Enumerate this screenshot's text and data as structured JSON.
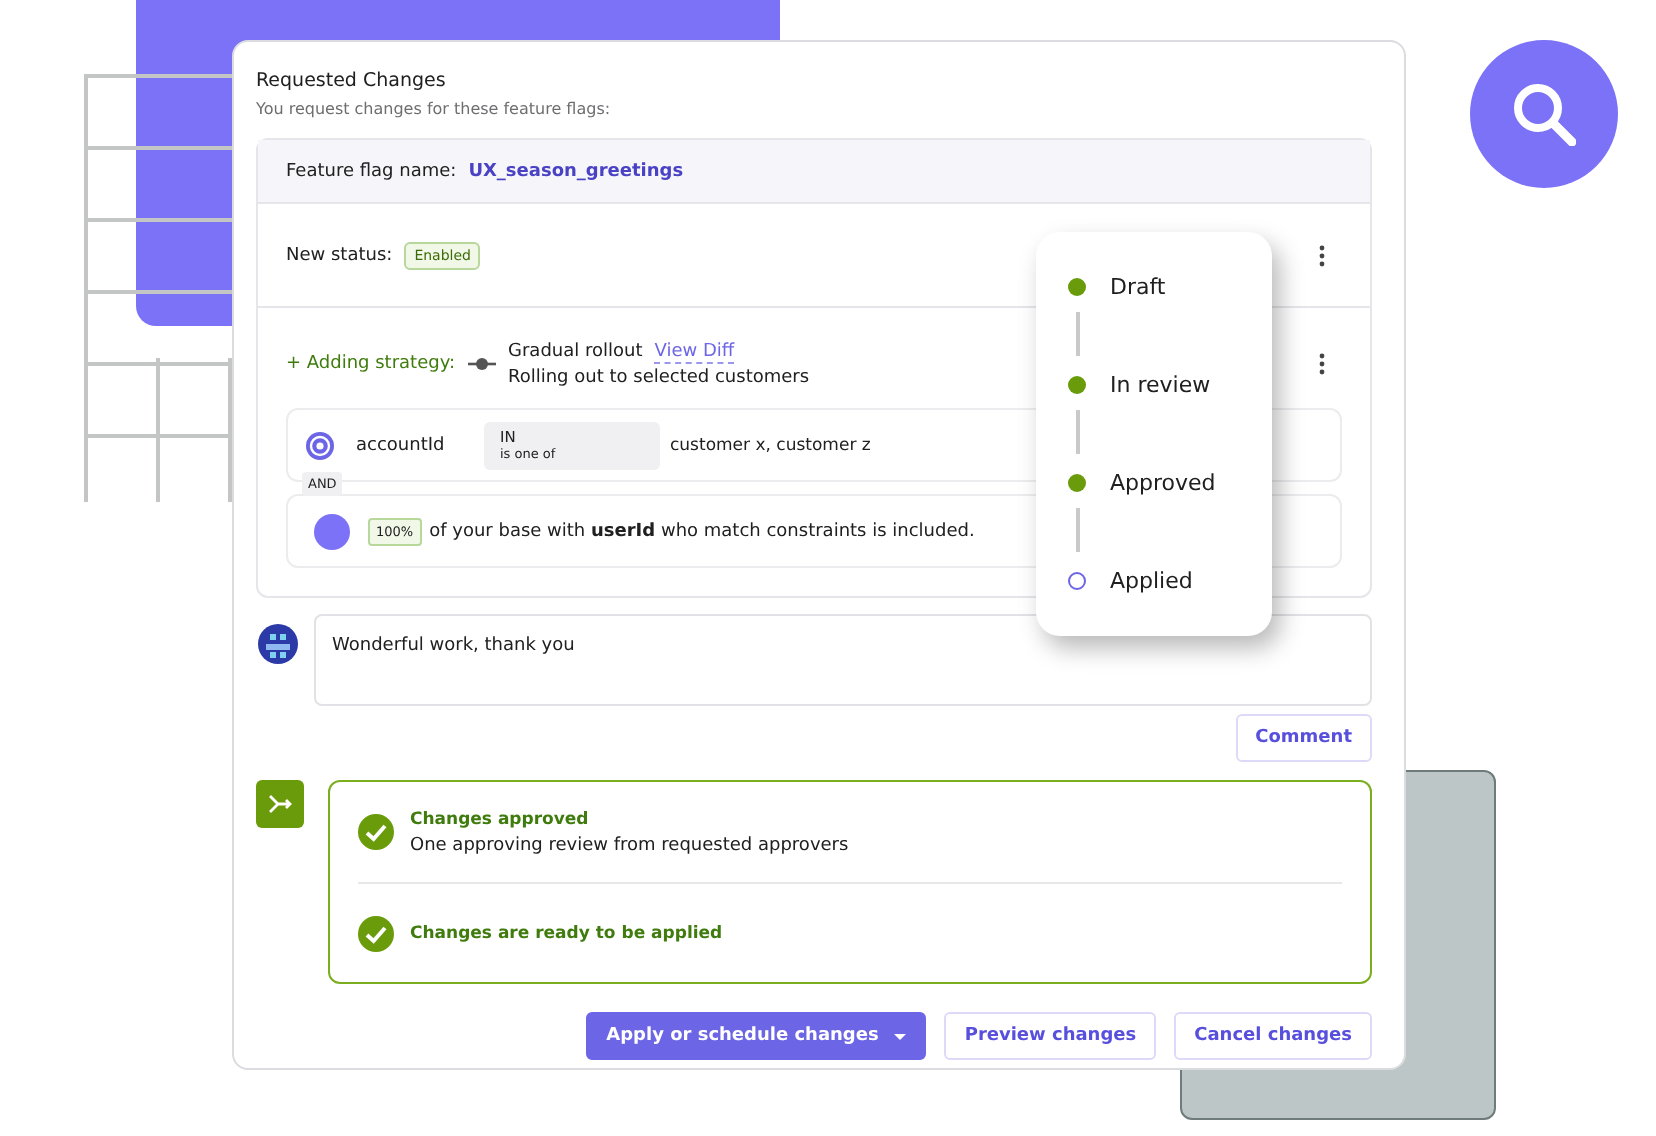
{
  "header": {
    "title": "Requested Changes",
    "subtitle": "You request changes for these feature flags:"
  },
  "flag": {
    "label": "Feature flag name:",
    "name": "UX_season_greetings"
  },
  "status": {
    "label": "New status:",
    "badge": "Enabled"
  },
  "strategy": {
    "label": "+ Adding strategy:",
    "name": "Gradual rollout",
    "link": "View Diff",
    "description": "Rolling out to selected customers",
    "constraint": {
      "field": "accountId",
      "operator": "IN",
      "operator_hint": "is one of",
      "values": "customer x, customer z"
    },
    "joiner": "AND",
    "rollout": {
      "percent": "100%",
      "text": "of your base with **userId** who match constraints is included."
    }
  },
  "comment": {
    "value": "Wonderful work, thank you",
    "button": "Comment"
  },
  "checks": [
    {
      "title": "Changes approved",
      "detail": "One approving review from requested approvers",
      "passed": true
    },
    {
      "title": "Changes are ready to be applied",
      "passed": true
    }
  ],
  "actions": [
    {
      "label": "Apply or schedule changes",
      "kind": "primary"
    },
    {
      "label": "Preview changes",
      "kind": "secondary"
    },
    {
      "label": "Cancel changes",
      "kind": "secondary"
    }
  ],
  "stepper": [
    {
      "label": "Draft",
      "done": true
    },
    {
      "label": "In review",
      "done": true
    },
    {
      "label": "Approved",
      "done": true
    },
    {
      "label": "Applied",
      "done": false
    }
  ]
}
